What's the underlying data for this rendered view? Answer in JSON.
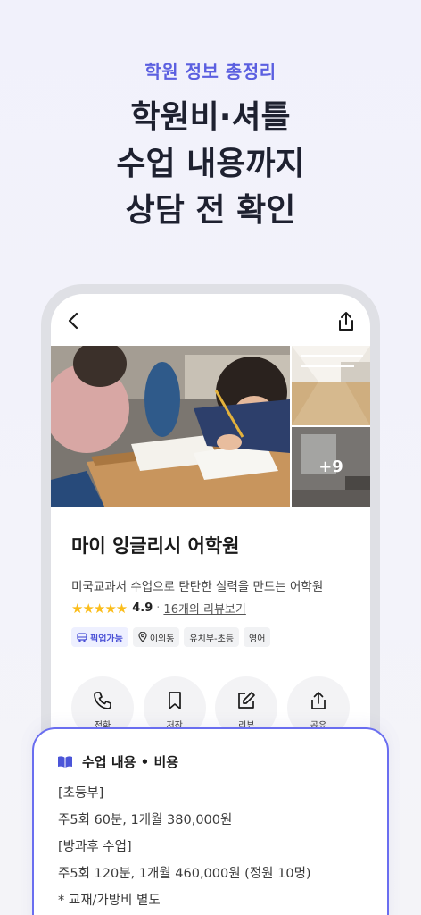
{
  "promo": {
    "eyebrow": "학원 정보 총정리",
    "title_lines": [
      "학원비·셔틀",
      "수업 내용까지",
      "상담 전 확인"
    ]
  },
  "nav": {
    "back_icon": "chevron-left-icon",
    "share_icon": "share-icon"
  },
  "gallery": {
    "more_count": "+9"
  },
  "academy": {
    "name": "마이 잉글리시 어학원",
    "description": "미국교과서 수업으로 탄탄한 실력을 만드는 어학원",
    "stars": "★★★★★",
    "rating": "4.9",
    "separator": "·",
    "review_link": "16개의 리뷰보기",
    "tags": [
      {
        "label": "픽업가능",
        "icon": "bus-icon"
      },
      {
        "label": "이의동",
        "icon": "location-pin-icon"
      },
      {
        "label": "유치부-초등"
      },
      {
        "label": "영어"
      }
    ]
  },
  "actions": [
    {
      "label": "전화",
      "icon": "phone-icon"
    },
    {
      "label": "저장",
      "icon": "bookmark-icon"
    },
    {
      "label": "리뷰",
      "icon": "edit-icon"
    },
    {
      "label": "공유",
      "icon": "share-icon"
    }
  ],
  "card": {
    "title": "수업 내용 • 비용",
    "icon": "book-icon",
    "lines": [
      "[초등부]",
      "주5회 60분, 1개월 380,000원",
      "[방과후 수업]",
      "주5회 120분, 1개월 460,000원 (정원 10명)",
      "* 교재/가방비 별도"
    ]
  },
  "colors": {
    "accent": "#5b5fe0",
    "star": "#fbbd1b",
    "card_border": "#6a6ef0"
  }
}
